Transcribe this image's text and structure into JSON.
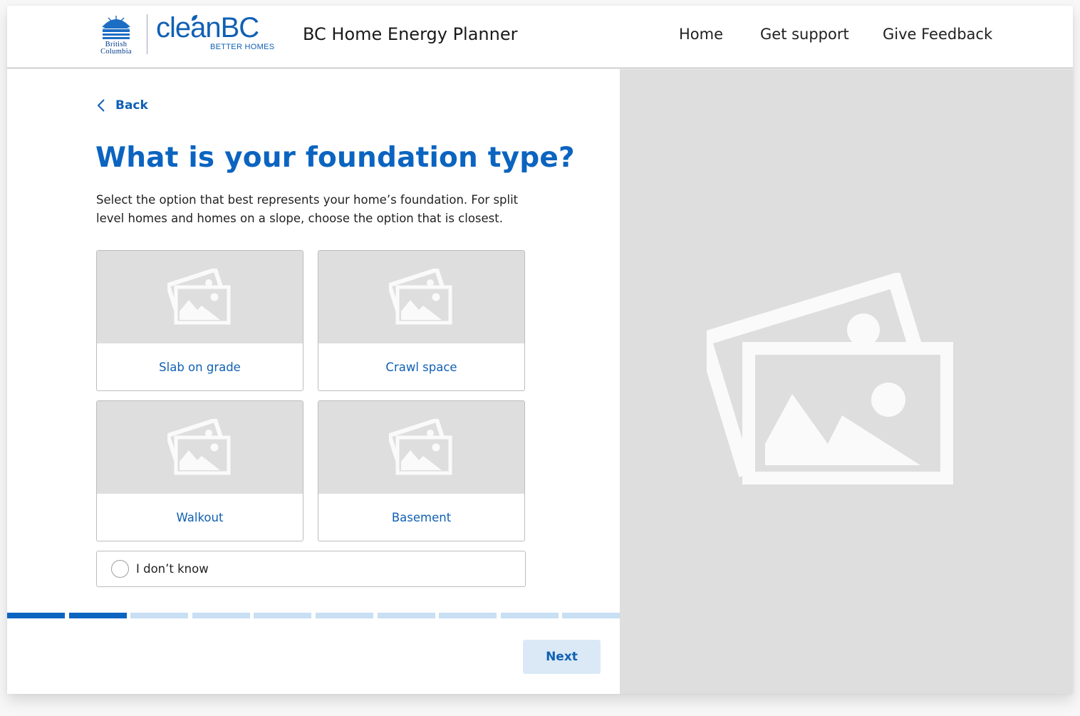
{
  "header": {
    "gov_logo_line1": "British",
    "gov_logo_line2": "Columbia",
    "brand_name": "cleanBC",
    "brand_sub": "BETTER HOMES",
    "app_title": "BC Home Energy Planner",
    "nav": {
      "home": "Home",
      "support": "Get support",
      "feedback": "Give Feedback"
    }
  },
  "main": {
    "back_label": "Back",
    "question": "What is your foundation type?",
    "description": "Select the option that best represents your home’s foundation. For split level homes and homes on a slope, choose the option that is closest.",
    "options": [
      {
        "label": "Slab on grade",
        "icon": "image-placeholder-icon"
      },
      {
        "label": "Crawl space",
        "icon": "image-placeholder-icon"
      },
      {
        "label": "Walkout",
        "icon": "image-placeholder-icon"
      },
      {
        "label": "Basement",
        "icon": "image-placeholder-icon"
      }
    ],
    "dont_know_label": "I don’t know",
    "dont_know_selected": false,
    "next_label": "Next"
  },
  "progress": {
    "total_steps": 10,
    "completed_steps": 2,
    "complete_color": "#0b64c0",
    "incomplete_color": "#c8dff4"
  },
  "side_panel": {
    "icon": "image-placeholder-icon"
  },
  "colors": {
    "primary": "#0b64c0",
    "link": "#1060b4",
    "placeholder_bg": "#dedede",
    "button_bg": "#dbe9f7"
  }
}
